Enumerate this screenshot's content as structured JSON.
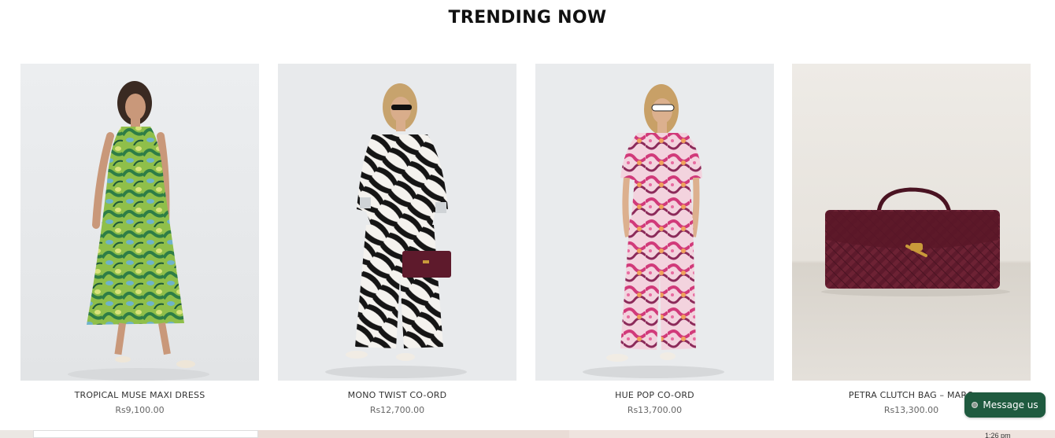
{
  "section": {
    "title": "TRENDING NOW"
  },
  "products": [
    {
      "name": "TROPICAL MUSE MAXI DRESS",
      "price": "Rs9,100.00",
      "image": "model-green-tropical-halter-dress"
    },
    {
      "name": "MONO TWIST CO-ORD",
      "price": "Rs12,700.00",
      "image": "model-black-white-zebra-coord"
    },
    {
      "name": "HUE POP CO-ORD",
      "price": "Rs13,700.00",
      "image": "model-pink-swirl-print-coord"
    },
    {
      "name": "PETRA CLUTCH BAG – MARO",
      "price": "Rs13,300.00",
      "image": "maroon-woven-clutch-bag"
    }
  ],
  "chat": {
    "label": "Message us",
    "icon": "status-dot-icon"
  },
  "system": {
    "clock": "1:26 pm"
  },
  "colors": {
    "chat_bg": "#1f5a3f",
    "bag": "#5e1a2c"
  }
}
